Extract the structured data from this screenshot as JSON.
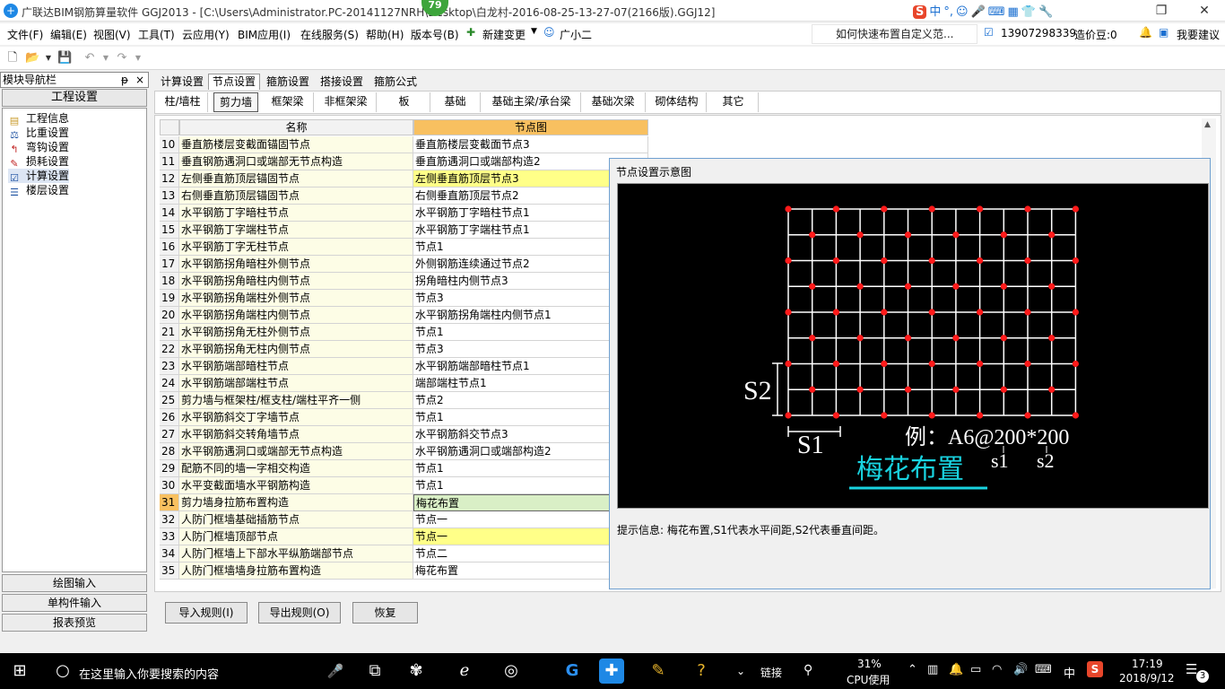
{
  "window": {
    "title": "广联达BIM钢筋算量软件 GGJ2013 - [C:\\Users\\Administrator.PC-20141127NRH\\Desktop\\白龙村-2016-08-25-13-27-07(2166版).GGJ12]",
    "badge": "79"
  },
  "menu": {
    "items": [
      "文件(F)",
      "编辑(E)",
      "视图(V)",
      "工具(T)",
      "云应用(Y)",
      "BIM应用(I)",
      "在线服务(S)",
      "帮助(H)",
      "版本号(B)",
      "新建变更",
      "广小二"
    ],
    "ad": "如何快速布置自定义范...",
    "phone": "13907298339",
    "coins": "造价豆:0",
    "suggest": "我要建议"
  },
  "nav": {
    "title": "模块导航栏",
    "pin": "ᵽ",
    "close": "×",
    "header": "工程设置",
    "items": [
      "工程信息",
      "比重设置",
      "弯钩设置",
      "损耗设置",
      "计算设置",
      "楼层设置"
    ],
    "buttons": [
      "绘图输入",
      "单构件输入",
      "报表预览"
    ]
  },
  "tabs1": [
    "计算设置",
    "节点设置",
    "箍筋设置",
    "搭接设置",
    "箍筋公式"
  ],
  "tabs2": [
    "柱/墙柱",
    "剪力墙",
    "框架梁",
    "非框架梁",
    "板",
    "基础",
    "基础主梁/承台梁",
    "基础次梁",
    "砌体结构",
    "其它"
  ],
  "grid": {
    "headers": [
      "名称",
      "节点图"
    ],
    "rows": [
      {
        "n": "10",
        "name": "垂直筋楼层变截面锚固节点",
        "node": "垂直筋楼层变截面节点3"
      },
      {
        "n": "11",
        "name": "垂直钢筋遇洞口或端部无节点构造",
        "node": "垂直筋遇洞口或端部构造2"
      },
      {
        "n": "12",
        "name": "左侧垂直筋顶层锚固节点",
        "node": "左侧垂直筋顶层节点3"
      },
      {
        "n": "13",
        "name": "右侧垂直筋顶层锚固节点",
        "node": "右侧垂直筋顶层节点2"
      },
      {
        "n": "14",
        "name": "水平钢筋丁字暗柱节点",
        "node": "水平钢筋丁字暗柱节点1"
      },
      {
        "n": "15",
        "name": "水平钢筋丁字端柱节点",
        "node": "水平钢筋丁字端柱节点1"
      },
      {
        "n": "16",
        "name": "水平钢筋丁字无柱节点",
        "node": "节点1"
      },
      {
        "n": "17",
        "name": "水平钢筋拐角暗柱外侧节点",
        "node": "外侧钢筋连续通过节点2"
      },
      {
        "n": "18",
        "name": "水平钢筋拐角暗柱内侧节点",
        "node": "拐角暗柱内侧节点3"
      },
      {
        "n": "19",
        "name": "水平钢筋拐角端柱外侧节点",
        "node": "节点3"
      },
      {
        "n": "20",
        "name": "水平钢筋拐角端柱内侧节点",
        "node": "水平钢筋拐角端柱内侧节点1"
      },
      {
        "n": "21",
        "name": "水平钢筋拐角无柱外侧节点",
        "node": "节点1"
      },
      {
        "n": "22",
        "name": "水平钢筋拐角无柱内侧节点",
        "node": "节点3"
      },
      {
        "n": "23",
        "name": "水平钢筋端部暗柱节点",
        "node": "水平钢筋端部暗柱节点1"
      },
      {
        "n": "24",
        "name": "水平钢筋端部端柱节点",
        "node": "端部端柱节点1"
      },
      {
        "n": "25",
        "name": "剪力墙与框架柱/框支柱/端柱平齐一侧",
        "node": "节点2"
      },
      {
        "n": "26",
        "name": "水平钢筋斜交丁字墙节点",
        "node": "节点1"
      },
      {
        "n": "27",
        "name": "水平钢筋斜交转角墙节点",
        "node": "水平钢筋斜交节点3"
      },
      {
        "n": "28",
        "name": "水平钢筋遇洞口或端部无节点构造",
        "node": "水平钢筋遇洞口或端部构造2"
      },
      {
        "n": "29",
        "name": "配筋不同的墙一字相交构造",
        "node": "节点1"
      },
      {
        "n": "30",
        "name": "水平变截面墙水平钢筋构造",
        "node": "节点1"
      },
      {
        "n": "31",
        "name": "剪力墙身拉筋布置构造",
        "node": "梅花布置"
      },
      {
        "n": "32",
        "name": "人防门框墙基础插筋节点",
        "node": "节点一"
      },
      {
        "n": "33",
        "name": "人防门框墙顶部节点",
        "node": "节点一"
      },
      {
        "n": "34",
        "name": "人防门框墙上下部水平纵筋端部节点",
        "node": "节点二"
      },
      {
        "n": "35",
        "name": "人防门框墙墙身拉筋布置构造",
        "node": "梅花布置"
      }
    ]
  },
  "preview": {
    "title": "节点设置示意图",
    "s1": "S1",
    "s2": "S2",
    "example": "例：A6@200*200",
    "sub1": "s1",
    "sub2": "s2",
    "caption": "梅花布置",
    "hint": "提示信息:  梅花布置,S1代表水平间距,S2代表垂直间距。"
  },
  "buttons": {
    "import": "导入规则(I)",
    "export": "导出规则(O)",
    "restore": "恢复"
  },
  "taskbar": {
    "search": "在这里输入你要搜索的内容",
    "link": "链接",
    "cpu_pct": "31%",
    "cpu_label": "CPU使用",
    "ime": "中",
    "time": "17:19",
    "date": "2018/9/12",
    "notif": "3"
  },
  "colors": {
    "dot": "#ff1a1a",
    "grid": "#ffffff",
    "caption": "#19d3e0",
    "highlight": "#ffff88",
    "selected": "#d9efc6"
  }
}
